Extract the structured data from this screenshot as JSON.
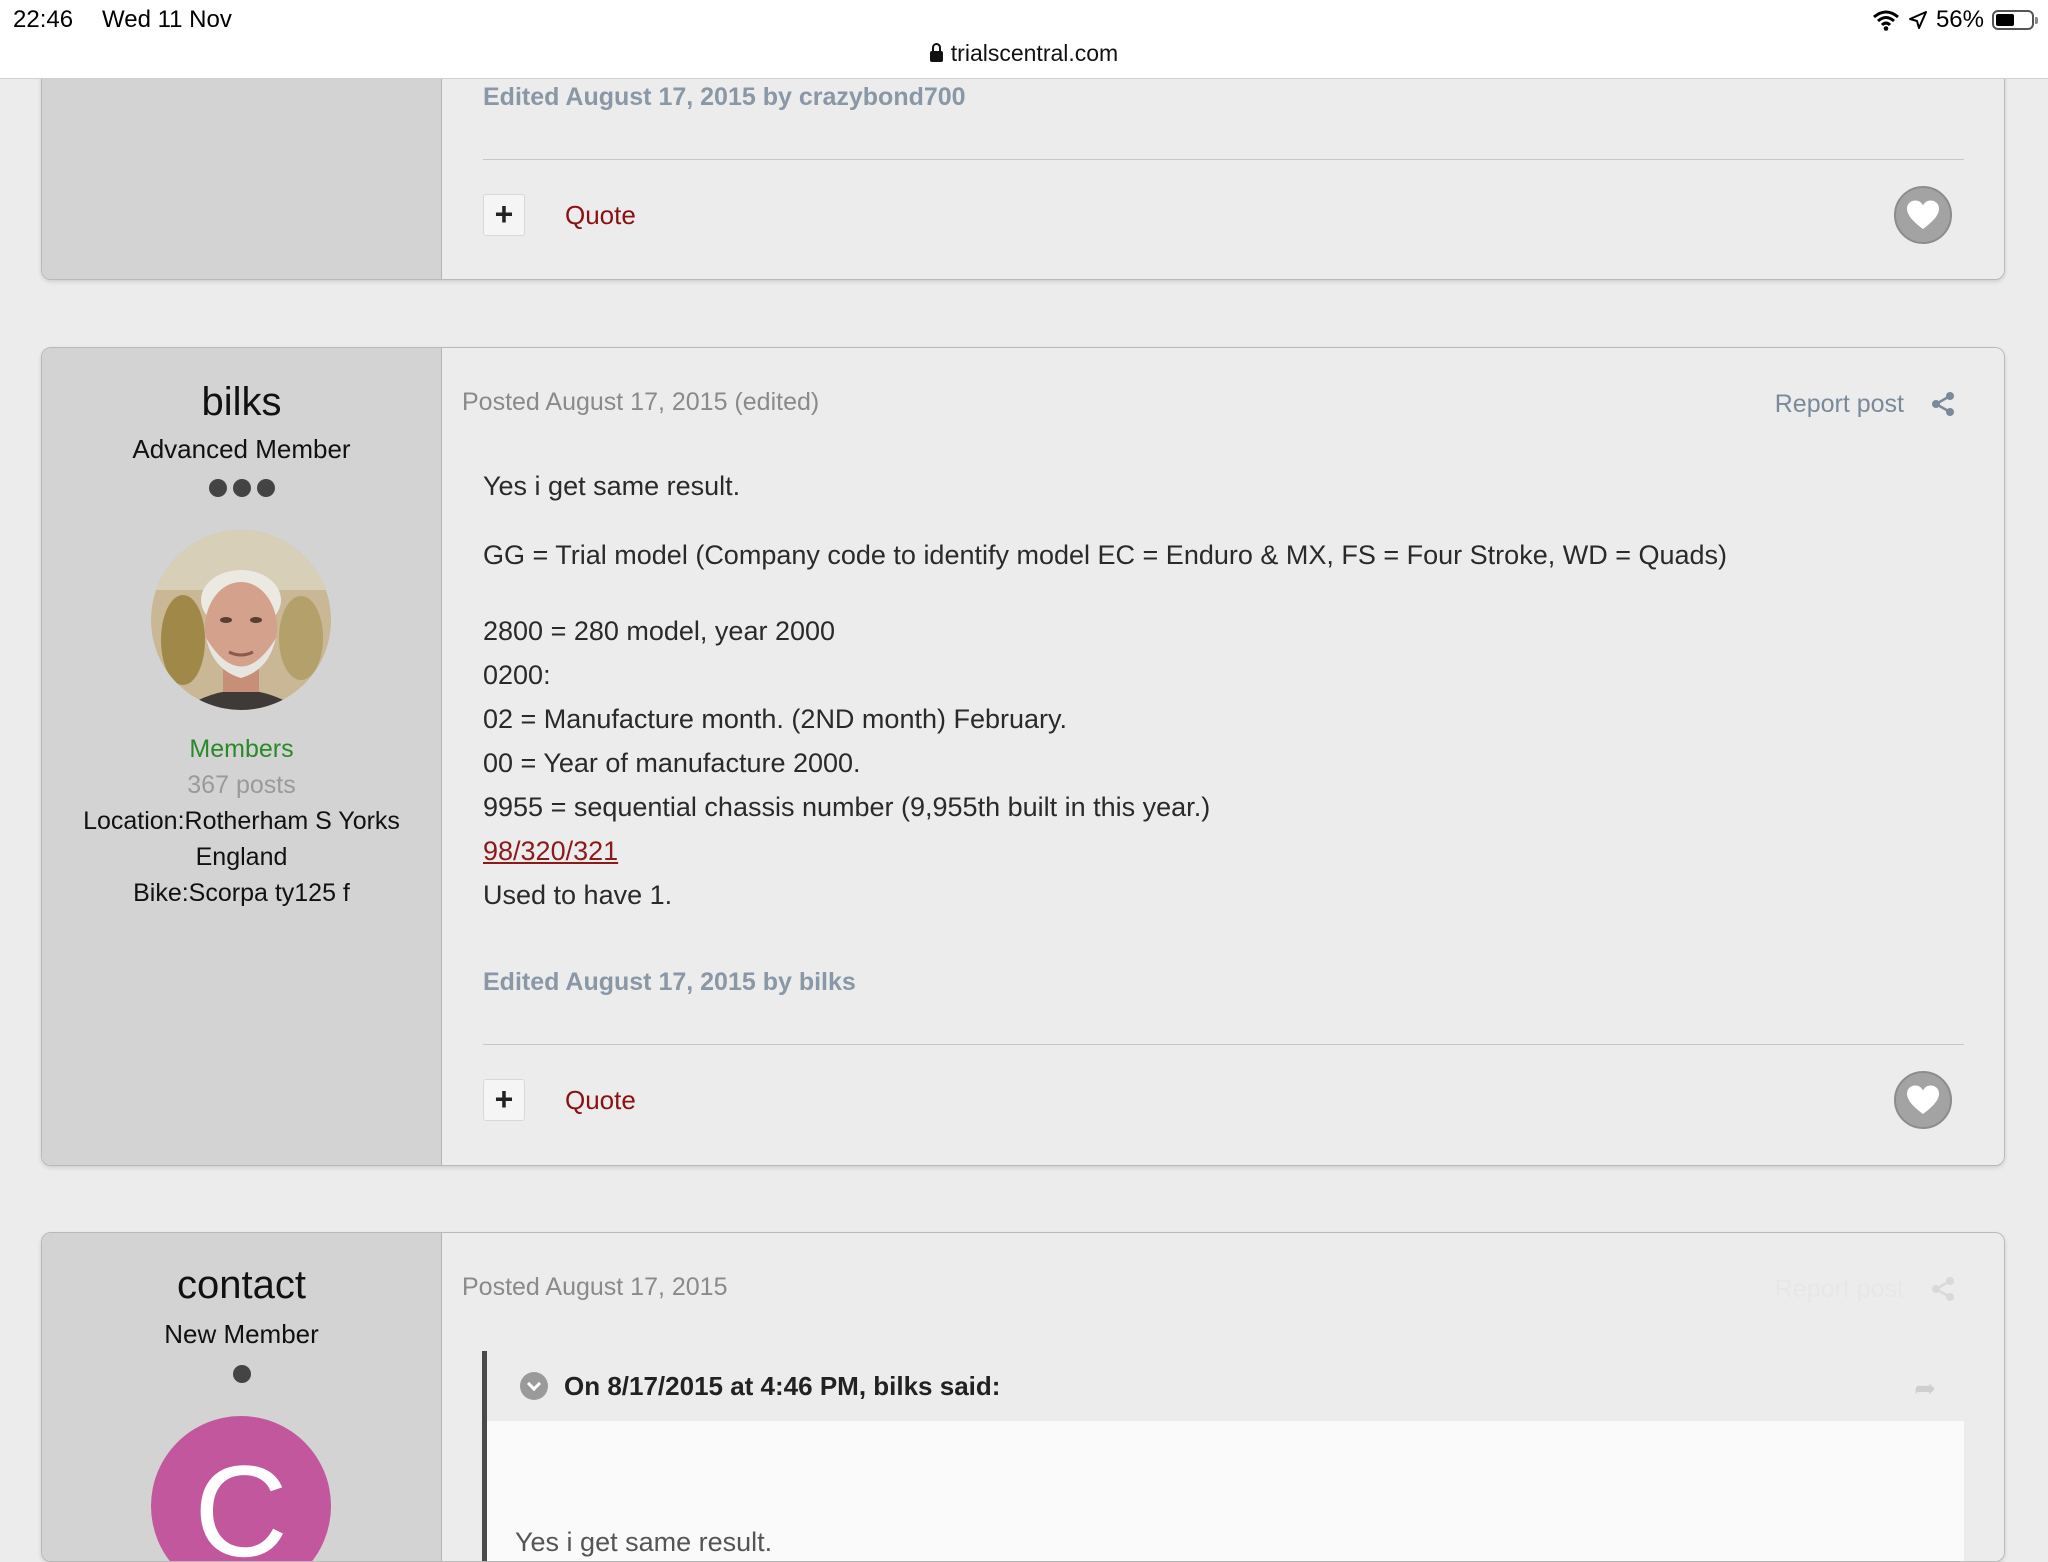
{
  "status_bar": {
    "time": "22:46",
    "date": "Wed 11 Nov",
    "url": "trialscentral.com",
    "battery": "56%",
    "battery_level": 0.56
  },
  "post_prev": {
    "edited_note": "Edited August 17, 2015 by crazybond700",
    "plus_label": "+",
    "quote_label": "Quote"
  },
  "post_bilks": {
    "author": {
      "name": "bilks",
      "title": "Advanced Member",
      "group": "Members",
      "posts": "367 posts",
      "location_line1": "Location:Rotherham S Yorks",
      "location_line2": "England",
      "bike": "Bike:Scorpa ty125 f"
    },
    "posted": "Posted August 17, 2015 (edited)",
    "report": "Report post",
    "body": {
      "line1": "Yes i get same result.",
      "line2": "GG = Trial model (Company code to identify model  EC = Enduro & MX, FS = Four Stroke, WD = Quads)",
      "line3": "2800 = 280 model, year 2000",
      "line4": "0200:",
      "line5": "02 = Manufacture month. (2ND month) February.",
      "line6": "00 = Year of manufacture 2000.",
      "line7": "9955 = sequential chassis number (9,955th built in this year.)",
      "link": "98/320/321",
      "line8": "Used to have 1."
    },
    "edited_note": "Edited August 17, 2015 by bilks",
    "plus_label": "+",
    "quote_label": "Quote"
  },
  "post_contact": {
    "author": {
      "name": "contact",
      "title": "New Member",
      "avatar_letter": "C"
    },
    "posted": "Posted August 17, 2015",
    "report": "Report post",
    "quote_title": "On 8/17/2015 at 4:46 PM, bilks said:",
    "quote_text": "Yes i get same result."
  },
  "colors": {
    "accent_red": "#8b1010",
    "group_green": "#2a8a2a",
    "avatar_pink": "#c2579e"
  }
}
